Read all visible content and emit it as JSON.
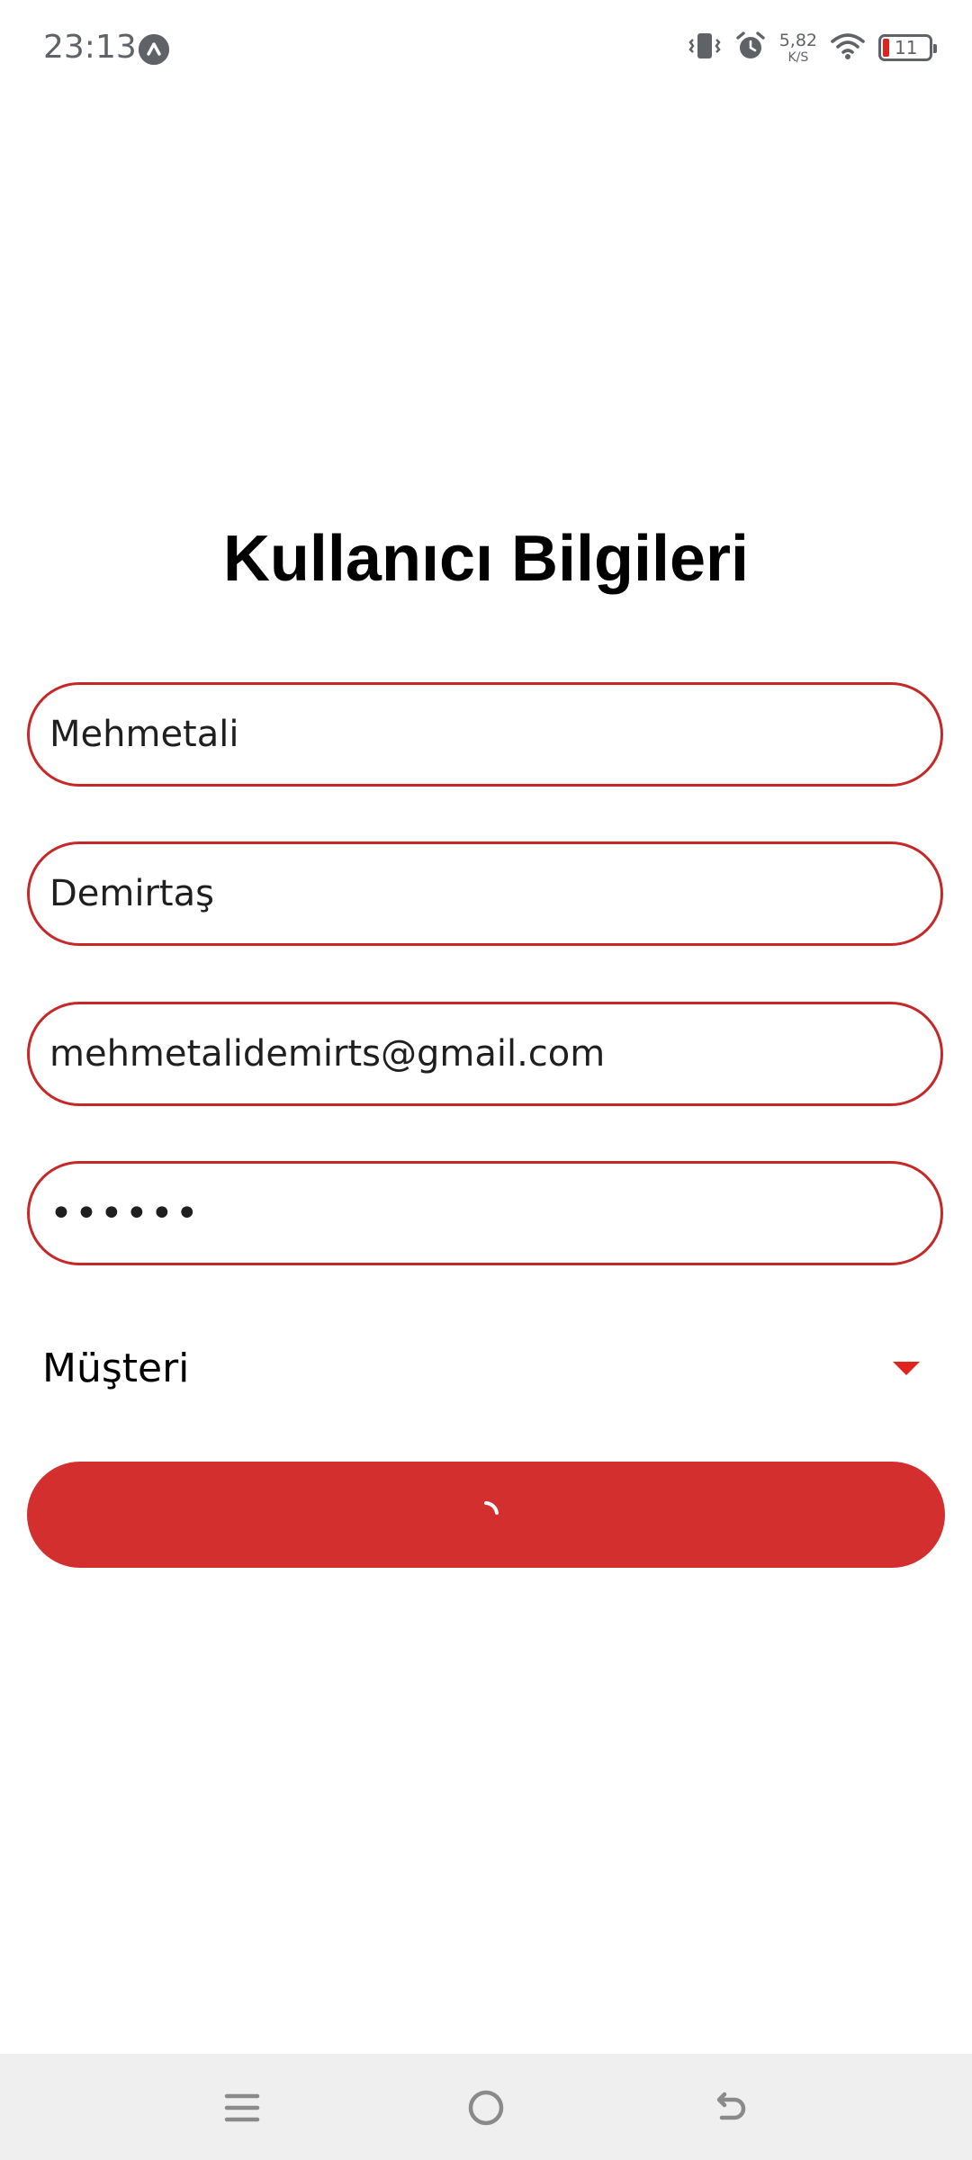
{
  "status_bar": {
    "time": "23:13",
    "speed_value": "5,82",
    "speed_unit": "K/S",
    "battery": "11",
    "icons": [
      "app-notification-icon",
      "vibrate-icon",
      "alarm-icon",
      "wifi-icon",
      "battery-icon"
    ]
  },
  "form": {
    "title": "Kullanıcı Bilgileri",
    "first_name": "Mehmetali",
    "last_name": "Demirtaş",
    "email": "mehmetalidemirts@gmail.com",
    "password": "••••••",
    "role_selected": "Müşteri",
    "submit_state": "loading"
  },
  "colors": {
    "accent": "#d32f2f",
    "field_border": "#c62828",
    "caret": "#e0231d",
    "nav_bg": "#efefef"
  },
  "nav": {
    "icons": [
      "menu-icon",
      "home-icon",
      "back-icon"
    ]
  }
}
